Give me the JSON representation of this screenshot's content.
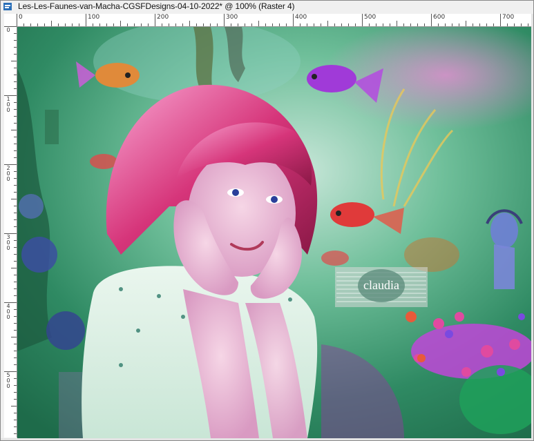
{
  "window": {
    "title": "Les-Les-Faunes-van-Macha-CGSFDesigns-04-10-2022* @ 100% (Raster 4)",
    "icon": "document-icon"
  },
  "rulers": {
    "top_labels": [
      "0",
      "100",
      "200",
      "300",
      "400",
      "500",
      "600",
      "700"
    ],
    "left_labels": [
      "0",
      "100",
      "200",
      "300",
      "400",
      "500"
    ]
  },
  "canvas": {
    "watermark_text": "claudia",
    "colors": {
      "background_green": "#3a8f6a",
      "hair_pink": "#d6357a",
      "fish_purple": "#a03ad8",
      "fish_red": "#e03a3a",
      "coral_purple": "#c046d8"
    }
  }
}
